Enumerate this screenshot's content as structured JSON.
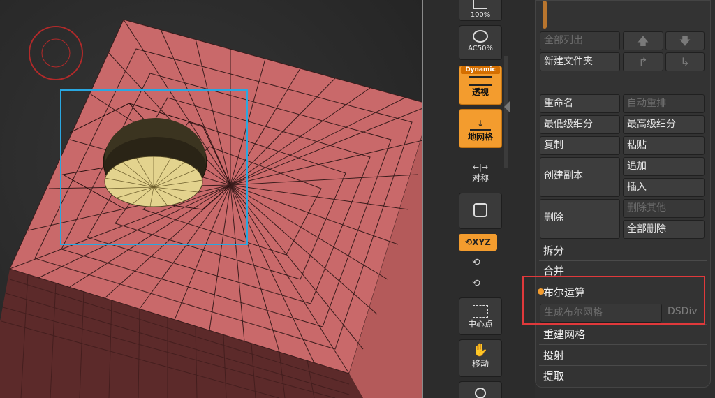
{
  "shelf": {
    "zoom_label": "100%",
    "ac50_label": "AC50%",
    "dynamic_badge": "Dynamic",
    "perspective_label": "透视",
    "floor_label": "地网格",
    "symmetry_label": "对称",
    "xyz_label": "XYZ",
    "center_label": "中心点",
    "move_label": "移动"
  },
  "subtool": {
    "list_all": "全部列出",
    "new_folder": "新建文件夹",
    "rename": "重命名",
    "auto_reorder": "自动重排",
    "lowest_subdiv": "最低级细分",
    "highest_subdiv": "最高级细分",
    "copy": "复制",
    "paste": "粘贴",
    "duplicate": "创建副本",
    "append": "追加",
    "insert": "插入",
    "delete": "删除",
    "delete_other": "删除其他",
    "delete_all": "全部删除",
    "split": "拆分",
    "merge": "合并",
    "boolean": "布尔运算",
    "make_boolean_mesh": "生成布尔网格",
    "dsdiv": "DSDiv",
    "remesh": "重建网格",
    "project": "投射",
    "extract": "提取"
  },
  "colors": {
    "accent": "#f39c2e",
    "mesh": "#c9696a",
    "highlight_box": "#e0393b",
    "selection_box": "#2aa7e0"
  }
}
